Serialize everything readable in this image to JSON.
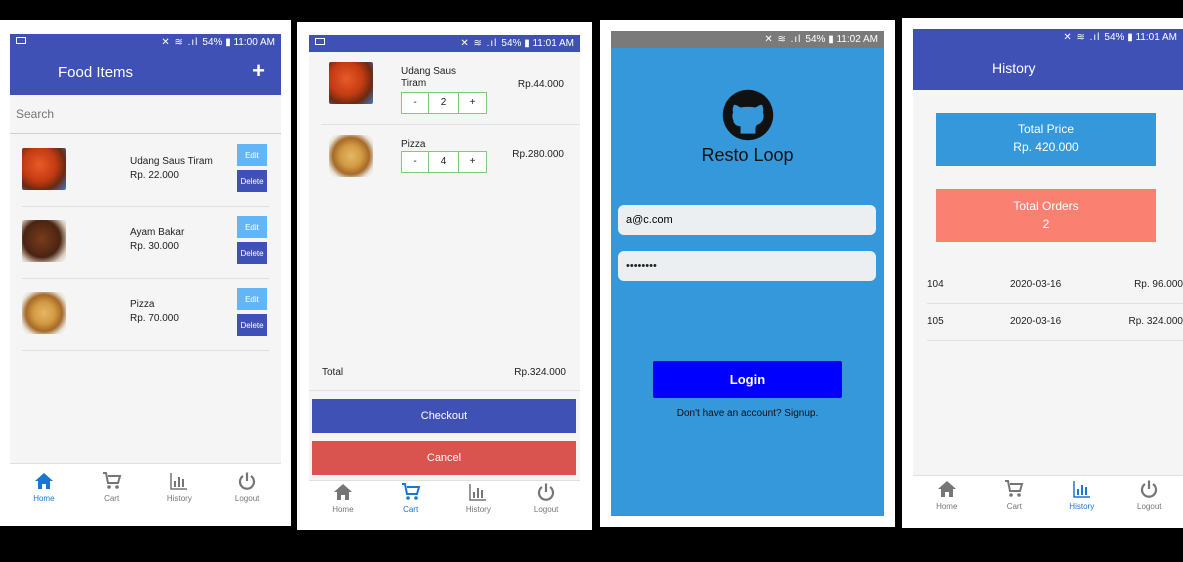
{
  "status": {
    "battery": "54%",
    "time1": "11:00 AM",
    "time2": "11:01 AM",
    "time3": "11:02 AM",
    "time4": "11:01 AM"
  },
  "screen1": {
    "title": "Food Items",
    "add_label": "+",
    "search_placeholder": "Search",
    "items": [
      {
        "name": "Udang Saus Tiram",
        "price": "Rp. 22.000",
        "image": "shrimp",
        "edit": "Edit",
        "delete": "Delete"
      },
      {
        "name": "Ayam Bakar",
        "price": "Rp. 30.000",
        "image": "grilled-chicken",
        "edit": "Edit",
        "delete": "Delete"
      },
      {
        "name": "Pizza",
        "price": "Rp. 70.000",
        "image": "pizza",
        "edit": "Edit",
        "delete": "Delete"
      }
    ]
  },
  "screen2": {
    "items": [
      {
        "name": "Udang Saus Tiram",
        "qty": "2",
        "price": "Rp.44.000",
        "minus": "-",
        "plus": "+"
      },
      {
        "name": "Pizza",
        "qty": "4",
        "price": "Rp.280.000",
        "minus": "-",
        "plus": "+"
      }
    ],
    "total_label": "Total",
    "total_value": "Rp.324.000",
    "checkout": "Checkout",
    "cancel": "Cancel"
  },
  "screen3": {
    "app_name": "Resto Loop",
    "email": "a@c.com",
    "password": "••••••••",
    "login": "Login",
    "signup_text": "Don't have an account? Signup."
  },
  "screen4": {
    "title": "History",
    "total_price_label": "Total Price",
    "total_price_value": "Rp. 420.000",
    "total_orders_label": "Total Orders",
    "total_orders_value": "2",
    "orders": [
      {
        "id": "104",
        "date": "2020-03-16",
        "amount": "Rp. 96.000"
      },
      {
        "id": "105",
        "date": "2020-03-16",
        "amount": "Rp. 324.000"
      }
    ]
  },
  "tabs": {
    "home": "Home",
    "cart": "Cart",
    "history": "History",
    "logout": "Logout"
  },
  "colors": {
    "primary": "#3f51b5",
    "accent_blue": "#1976d2",
    "login_bg": "#3498db",
    "login_button": "#0000ff",
    "cancel": "#d9534f",
    "orders_card": "#fa8072"
  }
}
